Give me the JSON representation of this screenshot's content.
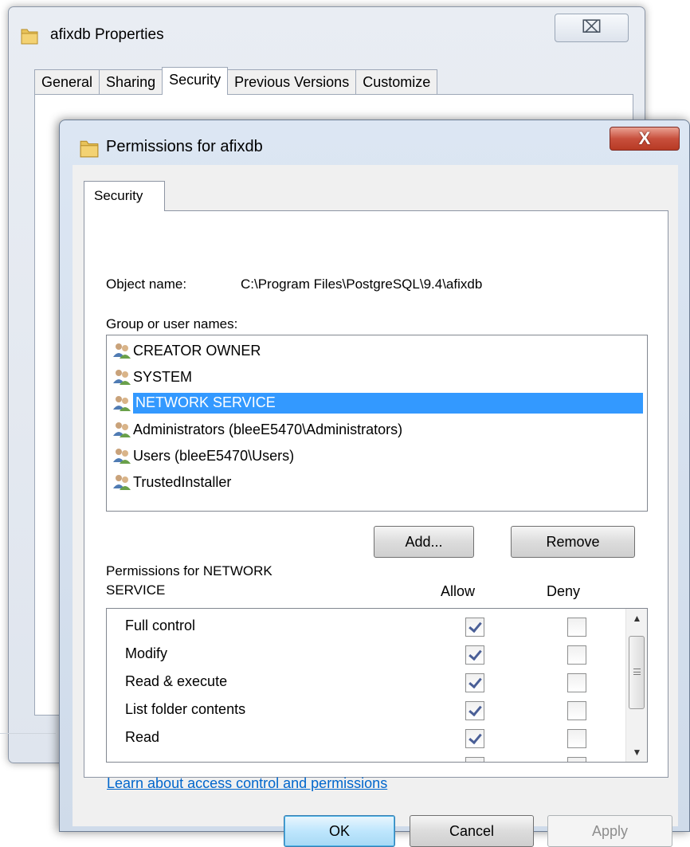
{
  "properties_window": {
    "title": "afixdb Properties",
    "close_glyph": "⌧",
    "tabs": [
      {
        "label": "General",
        "active": false
      },
      {
        "label": "Sharing",
        "active": false
      },
      {
        "label": "Security",
        "active": true
      },
      {
        "label": "Previous Versions",
        "active": false
      },
      {
        "label": "Customize",
        "active": false
      }
    ]
  },
  "permissions_window": {
    "title": "Permissions for afixdb",
    "close_glyph": "X",
    "tab_label": "Security",
    "object_name_label": "Object name:",
    "object_name_value": "C:\\Program Files\\PostgreSQL\\9.4\\afixdb",
    "group_label": "Group or user names:",
    "users": [
      {
        "name": "CREATOR OWNER",
        "selected": false
      },
      {
        "name": "SYSTEM",
        "selected": false
      },
      {
        "name": "NETWORK SERVICE",
        "selected": true
      },
      {
        "name": "Administrators (bleeE5470\\Administrators)",
        "selected": false
      },
      {
        "name": "Users (bleeE5470\\Users)",
        "selected": false
      },
      {
        "name": "TrustedInstaller",
        "selected": false
      }
    ],
    "add_button": "Add...",
    "remove_button": "Remove",
    "permissions_label_line1": "Permissions for NETWORK",
    "permissions_label_line2": "SERVICE",
    "allow_header": "Allow",
    "deny_header": "Deny",
    "permissions": [
      {
        "name": "Full control",
        "allow": true,
        "deny": false
      },
      {
        "name": "Modify",
        "allow": true,
        "deny": false
      },
      {
        "name": "Read & execute",
        "allow": true,
        "deny": false
      },
      {
        "name": "List folder contents",
        "allow": true,
        "deny": false
      },
      {
        "name": "Read",
        "allow": true,
        "deny": false
      }
    ],
    "learn_link": "Learn about access control and permissions",
    "ok_button": "OK",
    "cancel_button": "Cancel",
    "apply_button": "Apply"
  },
  "colors": {
    "selection": "#3399ff",
    "link": "#0066cc",
    "close_red": "#c8503d"
  }
}
